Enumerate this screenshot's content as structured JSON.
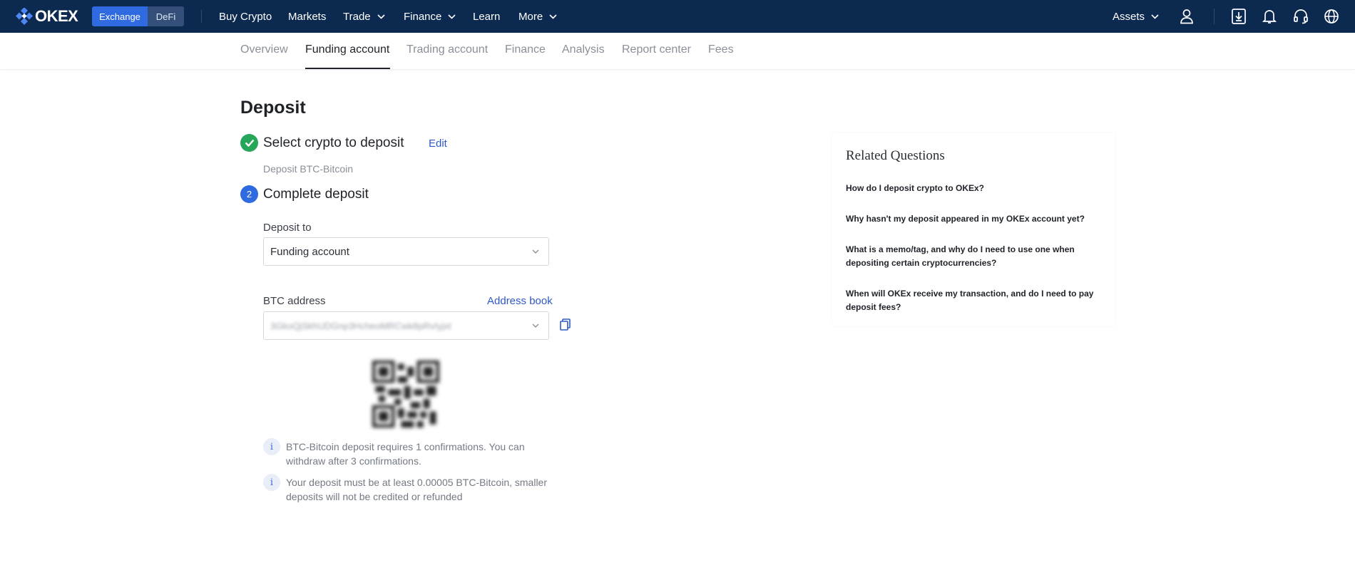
{
  "brand": {
    "name": "OKEX"
  },
  "switcher": {
    "exchange": "Exchange",
    "defi": "DeFi"
  },
  "nav": {
    "buy_crypto": "Buy Crypto",
    "markets": "Markets",
    "trade": "Trade",
    "finance": "Finance",
    "learn": "Learn",
    "more": "More",
    "assets": "Assets"
  },
  "subnav": {
    "overview": "Overview",
    "funding": "Funding account",
    "trading": "Trading account",
    "finance": "Finance",
    "analysis": "Analysis",
    "report": "Report center",
    "fees": "Fees"
  },
  "deposit": {
    "title": "Deposit",
    "step1_title": "Select crypto to deposit",
    "edit": "Edit",
    "step1_sub": "Deposit BTC-Bitcoin",
    "step2_number": "2",
    "step2_title": "Complete deposit",
    "deposit_to_label": "Deposit to",
    "deposit_to_value": "Funding account",
    "address_label": "BTC address",
    "address_book": "Address book",
    "address_value": "3GkoQjSkhUDGnp3HcheoMRCwk8pRvIyjxt",
    "info1": "BTC-Bitcoin deposit requires 1 confirmations. You can withdraw after 3 confirmations.",
    "info2": "Your deposit must be at least 0.00005 BTC-Bitcoin, smaller deposits will not be credited or refunded"
  },
  "related": {
    "title": "Related Questions",
    "q1": "How do I deposit crypto to OKEx?",
    "q2": "Why hasn't my deposit appeared in my OKEx account yet?",
    "q3": "What is a memo/tag, and why do I need to use one when depositing certain cryptocurrencies?",
    "q4": "When will OKEx receive my transaction, and do I need to pay deposit fees?"
  },
  "colors": {
    "topbar": "#0c2a50",
    "accent": "#2f6ae0",
    "success": "#26a65b",
    "link": "#2f58c8"
  }
}
